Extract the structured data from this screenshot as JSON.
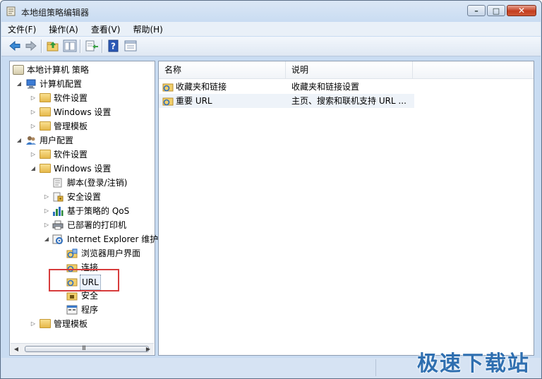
{
  "window": {
    "title": "本地组策略编辑器",
    "caption_buttons": {
      "minimize": "–",
      "maximize": "□",
      "close": "✕"
    }
  },
  "menu": [
    {
      "label": "文件(F)"
    },
    {
      "label": "操作(A)"
    },
    {
      "label": "查看(V)"
    },
    {
      "label": "帮助(H)"
    }
  ],
  "toolbar": {
    "buttons": [
      "back-arrow-icon",
      "forward-arrow-icon",
      "up-folder-icon",
      "show-hide-tree-icon",
      "export-list-icon",
      "help-icon",
      "filter-view-icon"
    ]
  },
  "tree": {
    "root": "本地计算机 策略",
    "computer_config": "计算机配置",
    "cc_software": "软件设置",
    "cc_windows": "Windows 设置",
    "cc_admin": "管理模板",
    "user_config": "用户配置",
    "uc_software": "软件设置",
    "uc_windows": "Windows 设置",
    "scripts": "脚本(登录/注销)",
    "security_settings": "安全设置",
    "qos": "基于策略的 QoS",
    "printers": "已部署的打印机",
    "ie": "Internet Explorer 维护",
    "browser_ui": "浏览器用户界面",
    "connection": "连接",
    "url": "URL",
    "security": "安全",
    "programs": "程序",
    "uc_admin": "管理模板",
    "scroll_grip": "III"
  },
  "list": {
    "columns": {
      "name": "名称",
      "description": "说明"
    },
    "rows": [
      {
        "name": "收藏夹和链接",
        "description": "收藏夹和链接设置"
      },
      {
        "name": "重要 URL",
        "description": "主页、搜索和联机支持 URL ..."
      }
    ]
  },
  "watermark": "极速下载站",
  "colors": {
    "highlight_box": "#d73c3c",
    "watermark": "#2f6fb0"
  }
}
